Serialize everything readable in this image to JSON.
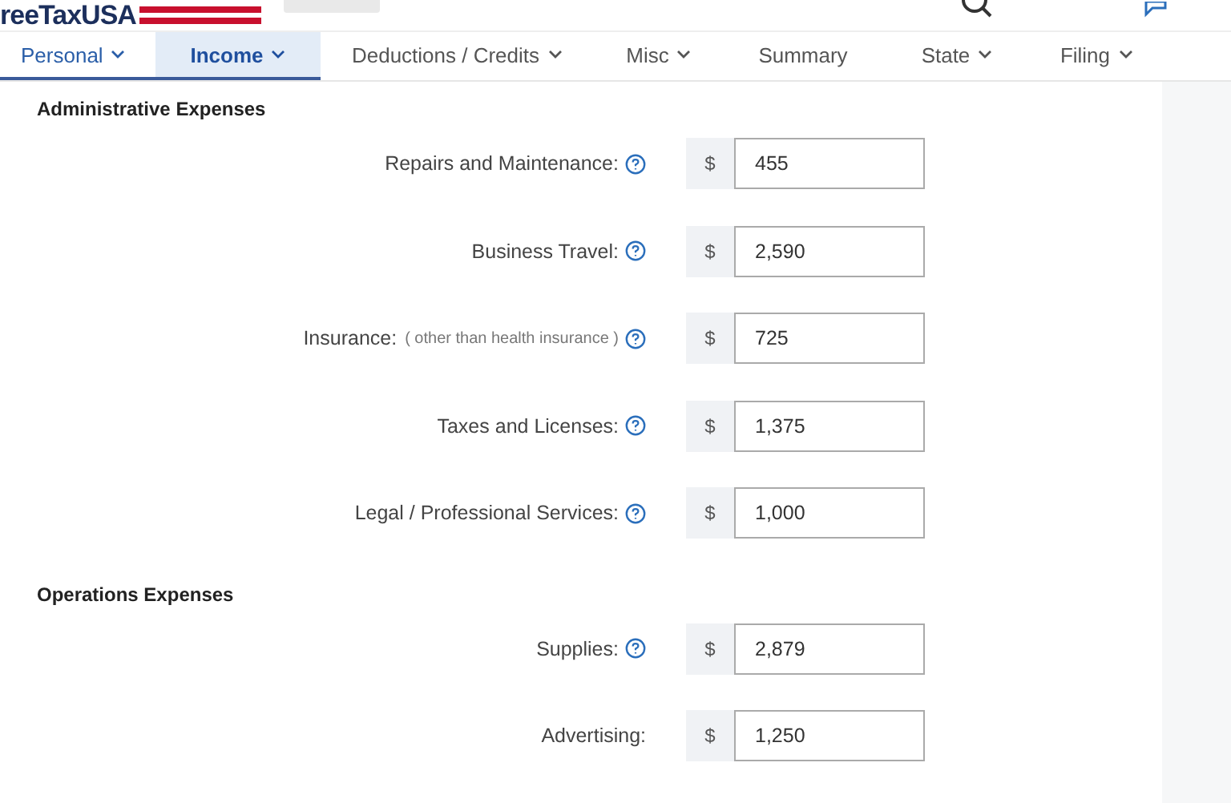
{
  "header": {
    "logo": "reeTaxUSA"
  },
  "tabs": [
    {
      "label": "Personal",
      "selected": false,
      "completed": true,
      "dropdown": true
    },
    {
      "label": "Income",
      "selected": true,
      "completed": true,
      "dropdown": true
    },
    {
      "label": "Deductions / Credits",
      "selected": false,
      "completed": false,
      "dropdown": true
    },
    {
      "label": "Misc",
      "selected": false,
      "completed": false,
      "dropdown": true
    },
    {
      "label": "Summary",
      "selected": false,
      "completed": false,
      "dropdown": false
    },
    {
      "label": "State",
      "selected": false,
      "completed": false,
      "dropdown": true
    },
    {
      "label": "Filing",
      "selected": false,
      "completed": false,
      "dropdown": true
    }
  ],
  "sections": [
    {
      "title": "Administrative Expenses",
      "fields": [
        {
          "label": "Repairs and Maintenance:",
          "help": true,
          "currency": "$",
          "value": "455"
        },
        {
          "label": "Business Travel:",
          "help": true,
          "currency": "$",
          "value": "2,590"
        },
        {
          "label": "Insurance:",
          "note": "( other than health insurance )",
          "help": true,
          "currency": "$",
          "value": "725"
        },
        {
          "label": "Taxes and Licenses:",
          "help": true,
          "currency": "$",
          "value": "1,375"
        },
        {
          "label": "Legal / Professional Services:",
          "help": true,
          "currency": "$",
          "value": "1,000"
        }
      ]
    },
    {
      "title": "Operations Expenses",
      "fields": [
        {
          "label": "Supplies:",
          "help": true,
          "currency": "$",
          "value": "2,879"
        },
        {
          "label": "Advertising:",
          "help": false,
          "currency": "$",
          "value": "1,250"
        }
      ]
    }
  ]
}
